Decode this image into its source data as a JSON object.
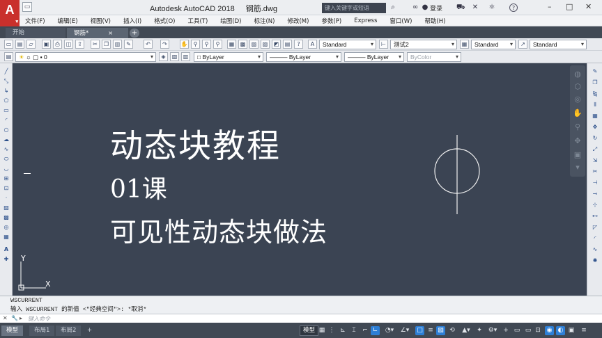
{
  "app": {
    "logo": "A",
    "product": "Autodesk AutoCAD 2018",
    "file": "钢筋.dwg",
    "search_placeholder": "键入关键字或短语",
    "login": "登录",
    "help": "?"
  },
  "menubar": {
    "items": [
      "文件(F)",
      "编辑(E)",
      "视图(V)",
      "插入(I)",
      "格式(O)",
      "工具(T)",
      "绘图(D)",
      "标注(N)",
      "修改(M)",
      "参数(P)",
      "Express",
      "窗口(W)",
      "帮助(H)"
    ]
  },
  "tabs": {
    "items": [
      {
        "label": "开始"
      },
      {
        "label": "钢筋*",
        "close": "×"
      }
    ],
    "add": "+"
  },
  "toolbar": {
    "text_style": "Standard",
    "dim_style": "测试2",
    "table_style": "Standard",
    "multileader_style": "Standard",
    "layer": "0",
    "color": "ByLayer",
    "linetype": "ByLayer",
    "lineweight": "ByLayer",
    "plotstyle": "ByColor"
  },
  "canvas": {
    "line1": "动态块教程",
    "line2": "01课",
    "line3": "可见性动态块做法",
    "ucs_y": "Y",
    "ucs_x": "X",
    "bg_color": "#3b4453"
  },
  "command": {
    "history1": "WSCURRENT",
    "history2": "输入 WSCURRENT 的新值 <\"经典空间\">: *取消*",
    "placeholder": "键入命令"
  },
  "status": {
    "layouts": [
      "模型",
      "布局1",
      "布局2"
    ],
    "add": "+",
    "model_label": "模型"
  }
}
